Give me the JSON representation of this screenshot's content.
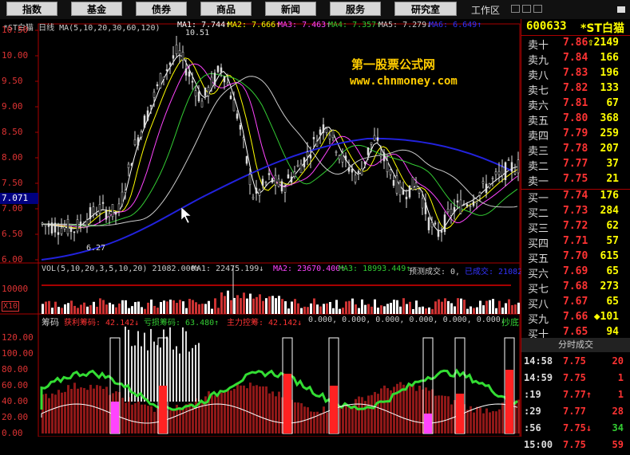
{
  "toolbar": {
    "buttons": [
      "指数",
      "基金",
      "债券",
      "商品",
      "新闻",
      "服务",
      "研究室"
    ],
    "workspace_label": "工作区"
  },
  "main_chart": {
    "title_line": "*ST白猫 日线  MA(5,10,20,30,60,120)",
    "ma_values": [
      {
        "label": "MA1: 7.744↑",
        "color": "#ffffff"
      },
      {
        "label": "MA2: 7.666↑",
        "color": "#ffff00"
      },
      {
        "label": "MA3: 7.463↑",
        "color": "#ff44ff"
      },
      {
        "label": "MA4: 7.357↑",
        "color": "#33cc33"
      },
      {
        "label": "MA5: 7.279↓",
        "color": "#cccccc"
      },
      {
        "label": "MA6: 6.649↑",
        "color": "#3333ff"
      }
    ],
    "y_ticks": [
      "10.50",
      "10.00",
      "9.50",
      "9.00",
      "8.50",
      "8.00",
      "7.50",
      "7.00",
      "6.50",
      "6.00"
    ],
    "high_annotation": "10.51",
    "low_annotation": "6.27",
    "cursor_price": "7.071",
    "watermark_cn": "第一股票公式网",
    "watermark_url": "www.chnmoney.com"
  },
  "volume_panel": {
    "header": "VOL(5,10,20,3,5,10,20)  21082.000↑",
    "ma1": "MA1: 22475.199↓",
    "ma2": "MA2: 23670.400↑",
    "ma3": "MA3: 18993.449↑",
    "est": "预测成交: 0,",
    "done": "已成交: 21082",
    "y_label": "10000",
    "unit_label": "X10"
  },
  "chip_panel": {
    "name": "筹码",
    "profit": "获利筹码: 42.142↓",
    "loss": "亏损筹码: 63.480↑",
    "main": "主力控筹: 42.142↓",
    "zeros": "0.000, 0.000, 0.000, 0.000, 0.000, 0.000,",
    "tag": "抄底",
    "y_ticks": [
      "120.00",
      "100.00",
      "80.00",
      "60.00",
      "40.00",
      "20.00",
      "0.00"
    ]
  },
  "quote_panel": {
    "code": "600633",
    "name": "*ST白猫",
    "order_book": [
      {
        "label": "卖十",
        "price": "7.86",
        "vol": "2149",
        "color": "#ff3333",
        "arrow": "⇧"
      },
      {
        "label": "卖九",
        "price": "7.84",
        "vol": "166",
        "color": "#ff3333"
      },
      {
        "label": "卖八",
        "price": "7.83",
        "vol": "196",
        "color": "#ff3333"
      },
      {
        "label": "卖七",
        "price": "7.82",
        "vol": "133",
        "color": "#ff3333"
      },
      {
        "label": "卖六",
        "price": "7.81",
        "vol": "67",
        "color": "#ff3333"
      },
      {
        "label": "卖五",
        "price": "7.80",
        "vol": "368",
        "color": "#ff3333"
      },
      {
        "label": "卖四",
        "price": "7.79",
        "vol": "259",
        "color": "#ff3333"
      },
      {
        "label": "卖三",
        "price": "7.78",
        "vol": "207",
        "color": "#ff3333"
      },
      {
        "label": "卖二",
        "price": "7.77",
        "vol": "37",
        "color": "#ff3333"
      },
      {
        "label": "卖一",
        "price": "7.75",
        "vol": "21",
        "color": "#ff3333"
      },
      {
        "label": "买一",
        "price": "7.74",
        "vol": "176",
        "color": "#ff3333"
      },
      {
        "label": "买二",
        "price": "7.73",
        "vol": "284",
        "color": "#ff3333"
      },
      {
        "label": "买三",
        "price": "7.72",
        "vol": "62",
        "color": "#ff3333"
      },
      {
        "label": "买四",
        "price": "7.71",
        "vol": "57",
        "color": "#ff3333"
      },
      {
        "label": "买五",
        "price": "7.70",
        "vol": "615",
        "color": "#ff3333"
      },
      {
        "label": "买六",
        "price": "7.69",
        "vol": "65",
        "color": "#ff3333"
      },
      {
        "label": "买七",
        "price": "7.68",
        "vol": "273",
        "color": "#ff3333"
      },
      {
        "label": "买八",
        "price": "7.67",
        "vol": "65",
        "color": "#ff3333"
      },
      {
        "label": "买九",
        "price": "7.66",
        "vol": "101",
        "color": "#ff3333",
        "arrow": "◆"
      },
      {
        "label": "买十",
        "price": "7.65",
        "vol": "94",
        "color": "#ff3333"
      }
    ],
    "ticks_title": "分时成交",
    "ticks": [
      {
        "time": "14:58",
        "price": "7.75",
        "vol": "20",
        "vcolor": "#ff3333"
      },
      {
        "time": "14:59",
        "price": "7.75",
        "vol": "1",
        "vcolor": "#ff3333"
      },
      {
        "time": ":19",
        "price": "7.77↑",
        "vol": "1",
        "vcolor": "#ff3333"
      },
      {
        "time": ":29",
        "price": "7.77",
        "vol": "28",
        "vcolor": "#ff3333"
      },
      {
        "time": ":56",
        "price": "7.75↓",
        "vol": "34",
        "vcolor": "#33cc33"
      },
      {
        "time": "15:00",
        "price": "7.75",
        "vol": "59",
        "vcolor": "#ff3333"
      }
    ]
  }
}
